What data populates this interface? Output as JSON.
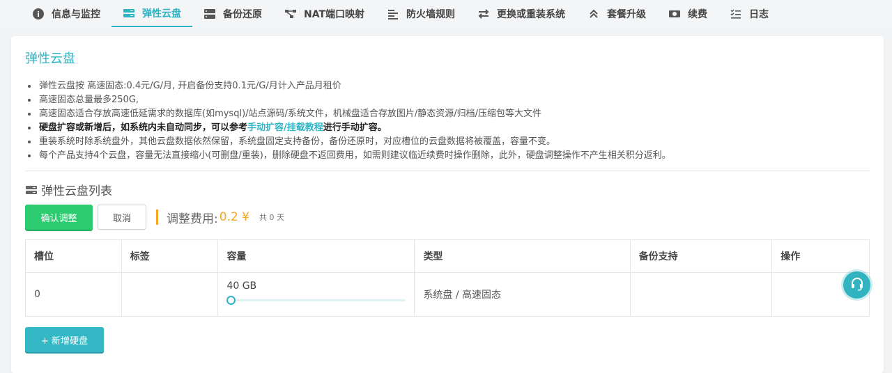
{
  "tabs": [
    {
      "label": "信息与监控",
      "icon": "info-icon"
    },
    {
      "label": "弹性云盘",
      "icon": "disk-icon",
      "active": true
    },
    {
      "label": "备份还原",
      "icon": "server-icon"
    },
    {
      "label": "NAT端口映射",
      "icon": "network-icon"
    },
    {
      "label": "防火墙规则",
      "icon": "list-icon"
    },
    {
      "label": "更换或重装系统",
      "icon": "swap-icon"
    },
    {
      "label": "套餐升级",
      "icon": "chevron-up-icon"
    },
    {
      "label": "续费",
      "icon": "money-icon"
    },
    {
      "label": "日志",
      "icon": "checklist-icon"
    }
  ],
  "page": {
    "title": "弹性云盘",
    "notes": [
      "弹性云盘按 高速固态:0.4元/G/月, 开启备份支持0.1元/G/月计入产品月租价",
      "高速固态总量最多250G,",
      "高速固态适合存放高速低延需求的数据库(如mysql)/站点源码/系统文件，机械盘适合存放图片/静态资源/归档/压缩包等大文件",
      "重装系统时除系统盘外，其他云盘数据依然保留，系统盘固定支持备份，备份还原时，对应槽位的云盘数据将被覆盖，容量不变。",
      "每个产品支持4个云盘，容量无法直接缩小(可删盘/重装)，删除硬盘不返回费用，如需则建议临近续费时操作删除，此外，硬盘调整操作不产生相关积分返利。"
    ],
    "bold_note": {
      "prefix": "硬盘扩容或新增后，如系统内未自动同步，可以参考",
      "link": "手动扩容/挂载教程",
      "suffix": "进行手动扩容。"
    }
  },
  "disk_list": {
    "title": "弹性云盘列表",
    "confirm_label": "确认调整",
    "cancel_label": "取消",
    "fee_label": "调整费用:",
    "fee_value": "0.2 ¥",
    "fee_days": "共 0 天",
    "columns": [
      "槽位",
      "标签",
      "容量",
      "类型",
      "备份支持",
      "操作"
    ],
    "rows": [
      {
        "slot": "0",
        "label": "",
        "capacity": "40 GB",
        "capacity_fill": 0,
        "type": "系统盘 / 高速固态",
        "backup": "",
        "action": ""
      }
    ],
    "add_label": "+ 新增硬盘"
  },
  "colors": {
    "accent": "#2fb4c4",
    "confirm": "#2ecc71",
    "fee": "#f5a623"
  }
}
